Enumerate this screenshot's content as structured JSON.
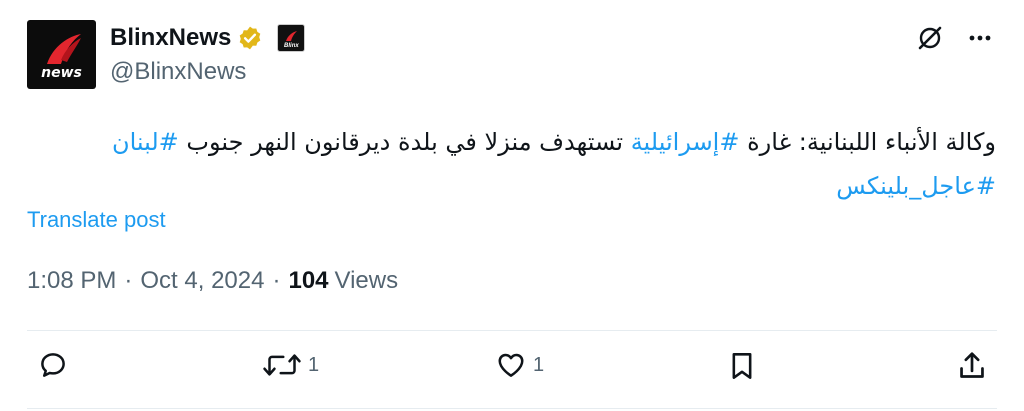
{
  "author": {
    "display_name": "BlinxNews",
    "handle": "@BlinxNews",
    "avatar_text": "news",
    "affiliate_badge_text": "Blinx",
    "verified_badge_color": "#e2b719"
  },
  "icons": {
    "grok": "grok-icon",
    "more": "more-icon",
    "reply": "reply-icon",
    "repost": "repost-icon",
    "like": "like-icon",
    "bookmark": "bookmark-icon",
    "share": "share-icon"
  },
  "tweet": {
    "text_part1": "وكالة الأنباء اللبنانية: غارة ",
    "hashtag1": "#إسرائيلية",
    "text_part2": " تستهدف منزلا في بلدة ديرقانون النهر جنوب ",
    "hashtag2": "#لبنان",
    "hashtag3": "#عاجل_بلينكس"
  },
  "translate_label": "Translate post",
  "meta": {
    "time": "1:08 PM",
    "separator": "·",
    "date": "Oct 4, 2024",
    "views_count": "104",
    "views_label": "Views"
  },
  "actions": {
    "reply_count": "",
    "repost_count": "1",
    "like_count": "1"
  },
  "colors": {
    "link": "#1d9bf0",
    "muted": "#536471",
    "text": "#0f1419"
  }
}
